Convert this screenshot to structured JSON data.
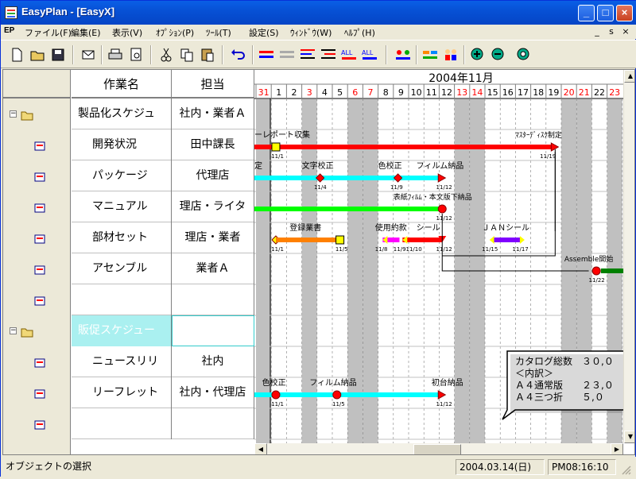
{
  "window": {
    "title": "EasyPlan - [EasyX]"
  },
  "titlebar": {
    "min": "_",
    "max": "□",
    "close": "×"
  },
  "menubar": {
    "logo": "EP",
    "items": [
      "ファイル(F)",
      "編集(E)",
      "表示(V)",
      "ｵﾌﾟｼｮﾝ(P)",
      "ﾂｰﾙ(T)",
      "設定(S)",
      "ｳｨﾝﾄﾞｳ(W)",
      "ﾍﾙﾌﾟ(H)"
    ],
    "mdi_min": "_",
    "mdi_restore": "ꜱ",
    "mdi_close": "×"
  },
  "toolbar": {
    "icons": [
      "new-icon",
      "open-icon",
      "save-icon",
      "mail-icon",
      "print-icon",
      "preview-icon",
      "cut-icon",
      "copy-icon",
      "paste-icon",
      "undo-icon",
      "bar-insert-icon",
      "bar-delete-icon",
      "bar-align-icon",
      "bar-outdent-icon",
      "align-all-icon",
      "align-date-icon",
      "link-icon",
      "resource-icon",
      "people-icon",
      "zoom-in-icon",
      "zoom-out-icon",
      "zoom-fit-icon"
    ]
  },
  "grid": {
    "col_task": "作業名",
    "col_owner": "担当"
  },
  "tasks": [
    {
      "name": "製品化スケジュ",
      "owner": "社内・業者Ａ",
      "group": true,
      "highlight": false
    },
    {
      "name": "開発状況",
      "owner": "田中課長",
      "group": false,
      "highlight": false
    },
    {
      "name": "パッケージ",
      "owner": "代理店",
      "group": false,
      "highlight": false
    },
    {
      "name": "マニュアル",
      "owner": "理店・ライタ",
      "group": false,
      "highlight": false
    },
    {
      "name": "部材セット",
      "owner": "理店・業者",
      "group": false,
      "highlight": false
    },
    {
      "name": "アセンブル",
      "owner": "業者Ａ",
      "group": false,
      "highlight": false
    },
    {
      "name": "",
      "owner": "",
      "group": false,
      "highlight": false
    },
    {
      "name": "販促スケジュー",
      "owner": "",
      "group": true,
      "highlight": true
    },
    {
      "name": "ニュースリリ",
      "owner": "社内",
      "group": false,
      "highlight": false
    },
    {
      "name": "リーフレット",
      "owner": "社内・代理店",
      "group": false,
      "highlight": false
    },
    {
      "name": "",
      "owner": "",
      "group": false,
      "highlight": false
    }
  ],
  "calendar": {
    "month_label": "2004年11月",
    "days": [
      "31",
      "1",
      "2",
      "3",
      "4",
      "5",
      "6",
      "7",
      "8",
      "9",
      "10",
      "11",
      "12",
      "13",
      "14",
      "15",
      "16",
      "17",
      "18",
      "19",
      "20",
      "21",
      "22",
      "23"
    ],
    "red_days": [
      "31",
      "3",
      "6",
      "7",
      "13",
      "14",
      "20",
      "21",
      "23"
    ]
  },
  "bars": [
    {
      "row": 1,
      "color": "#ff0000",
      "start": 0,
      "end": 19.6,
      "label_start": "ーレポート収集",
      "label_end": "ﾏｽﾀｰﾃﾞｨｽｸ制定",
      "date_start": "11/1",
      "date_end": "11/19"
    },
    {
      "row": 2,
      "color": "#00ffff",
      "start": 0,
      "end": 12,
      "labels": [
        "定",
        "文字校正",
        "色校正",
        "フィルム納品"
      ],
      "dates": [
        "11/4",
        "11/9",
        "11/12"
      ]
    },
    {
      "row": 3,
      "color": "#00ff00",
      "start": 0,
      "end": 12,
      "labels": [
        "表紙ﾌｨﾙﾑ・本文版下納品"
      ],
      "dates": [
        "11/12"
      ]
    },
    {
      "row": 4,
      "segments": [
        {
          "color": "#ff8000",
          "start": 1,
          "end": 5,
          "label": "登録業書",
          "d1": "11/1",
          "d2": "11/5"
        },
        {
          "color": "#ff00ff",
          "start": 8,
          "end": 9.3,
          "label": "使用約款"
        },
        {
          "color": "#ff0000",
          "start": 9.3,
          "end": 12,
          "label": "シール"
        },
        {
          "color": "#8000ff",
          "start": 15,
          "end": 17,
          "label": "ＪＡＮシール",
          "d1": "11/15",
          "d2": "11/17"
        }
      ],
      "dates": [
        "11/8",
        "11/9",
        "11/10",
        "11/12"
      ]
    },
    {
      "row": 5,
      "color": "#008000",
      "start": 22,
      "end": 24,
      "label": "Assemble開始",
      "date": "11/22"
    },
    {
      "row": 9,
      "color": "#00ffff",
      "start": 0,
      "end": 12,
      "labels": [
        "色校正",
        "フィルム納品",
        "初台納品"
      ],
      "dates": [
        "11/1",
        "11/5",
        "11/12"
      ]
    }
  ],
  "callout": {
    "lines": [
      "カタログ総数　３０,０",
      "＜内訳＞",
      "Ａ４通常版　　２３,０",
      "Ａ４三つ折　　５,０"
    ]
  },
  "statusbar": {
    "message": "オブジェクトの選択",
    "date": "2004.03.14(日)",
    "time": "PM08:16:10"
  },
  "colors": {
    "titlebar": "#0a5fe6",
    "weekend_column": "#c0c0c0",
    "group_highlight": "#aaf0f0",
    "diamond": "#ff0000",
    "milestone_yellow": "#ffff00"
  }
}
